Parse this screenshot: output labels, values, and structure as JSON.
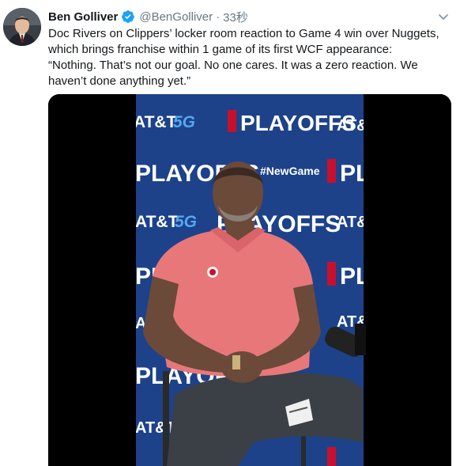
{
  "tweet": {
    "author": {
      "display_name": "Ben Golliver",
      "handle": "@BenGolliver",
      "verified": true
    },
    "separator": "·",
    "timestamp": "33秒",
    "text_lines": [
      "Doc Rivers on Clippers’ locker room reaction to Game 4 win over Nuggets,",
      "which brings franchise within 1 game of its first WCF appearance:",
      "“Nothing. That’s not our goal. No one cares. It was a zero reaction. We",
      "haven’t done anything yet.”"
    ],
    "media": {
      "type": "video",
      "backdrop_text": {
        "att": "AT&T",
        "fiveg": "5G",
        "playoffs": "PLAYOFFS",
        "newgame": "#NewGame"
      }
    }
  },
  "colors": {
    "verified_blue": "#1da1f2",
    "backdrop_blue": "#1d428a",
    "shirt_red": "#e8777a",
    "text_primary": "#14171a",
    "text_secondary": "#657786"
  },
  "icons": {
    "verified": "verified-badge-icon",
    "menu": "chevron-down-icon"
  }
}
